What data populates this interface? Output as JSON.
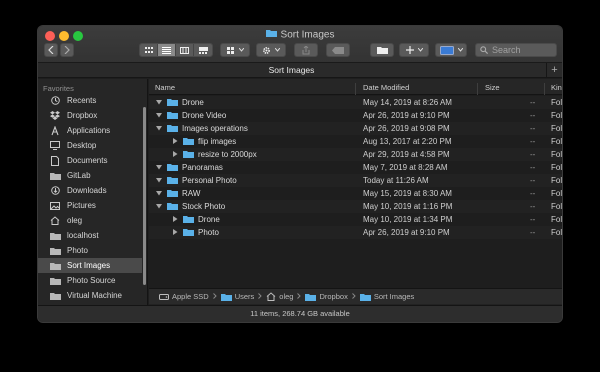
{
  "window": {
    "title": "Sort Images"
  },
  "toolbar": {
    "back_icon": "chevron-left-icon",
    "forward_icon": "chevron-right-icon",
    "view_modes": [
      "icon-view",
      "list-view",
      "column-view",
      "gallery-view"
    ],
    "selected_view": "list-view",
    "search_placeholder": "Search"
  },
  "tab": {
    "label": "Sort Images",
    "add_label": "+"
  },
  "sidebar": {
    "header": "Favorites",
    "items": [
      {
        "label": "Recents",
        "icon": "clock-icon"
      },
      {
        "label": "Dropbox",
        "icon": "dropbox-icon"
      },
      {
        "label": "Applications",
        "icon": "applications-icon"
      },
      {
        "label": "Desktop",
        "icon": "desktop-icon"
      },
      {
        "label": "Documents",
        "icon": "documents-icon"
      },
      {
        "label": "GitLab",
        "icon": "folder-icon"
      },
      {
        "label": "Downloads",
        "icon": "downloads-icon"
      },
      {
        "label": "Pictures",
        "icon": "pictures-icon"
      },
      {
        "label": "oleg",
        "icon": "home-icon"
      },
      {
        "label": "localhost",
        "icon": "folder-icon"
      },
      {
        "label": "Photo",
        "icon": "folder-icon"
      },
      {
        "label": "Sort Images",
        "icon": "folder-icon",
        "selected": true
      },
      {
        "label": "Photo Source",
        "icon": "folder-icon"
      },
      {
        "label": "Virtual Machine",
        "icon": "folder-icon"
      }
    ]
  },
  "columns": {
    "name": "Name",
    "date": "Date Modified",
    "size": "Size",
    "kind": "Kin"
  },
  "rows": [
    {
      "name": "Drone",
      "date": "May 14, 2019 at 8:26 AM",
      "size": "--",
      "kind": "Fol",
      "level": 0,
      "expanded": true
    },
    {
      "name": "Drone Video",
      "date": "Apr 26, 2019 at 9:10 PM",
      "size": "--",
      "kind": "Fol",
      "level": 0,
      "expanded": true
    },
    {
      "name": "Images operations",
      "date": "Apr 26, 2019 at 9:08 PM",
      "size": "--",
      "kind": "Fol",
      "level": 0,
      "expanded": true
    },
    {
      "name": "flip images",
      "date": "Aug 13, 2017 at 2:20 PM",
      "size": "--",
      "kind": "Fol",
      "level": 1,
      "expanded": false
    },
    {
      "name": "resize to 2000px",
      "date": "Apr 29, 2019 at 4:58 PM",
      "size": "--",
      "kind": "Fol",
      "level": 1,
      "expanded": false
    },
    {
      "name": "Panoramas",
      "date": "May 7, 2019 at 8:28 AM",
      "size": "--",
      "kind": "Fol",
      "level": 0,
      "expanded": true
    },
    {
      "name": "Personal Photo",
      "date": "Today at 11:26 AM",
      "size": "--",
      "kind": "Fol",
      "level": 0,
      "expanded": true
    },
    {
      "name": "RAW",
      "date": "May 15, 2019 at 8:30 AM",
      "size": "--",
      "kind": "Fol",
      "level": 0,
      "expanded": true
    },
    {
      "name": "Stock Photo",
      "date": "May 10, 2019 at 1:16 PM",
      "size": "--",
      "kind": "Fol",
      "level": 0,
      "expanded": true
    },
    {
      "name": "Drone",
      "date": "May 10, 2019 at 1:34 PM",
      "size": "--",
      "kind": "Fol",
      "level": 1,
      "expanded": false
    },
    {
      "name": "Photo",
      "date": "Apr 26, 2019 at 9:10 PM",
      "size": "--",
      "kind": "Fol",
      "level": 1,
      "expanded": false
    }
  ],
  "path": [
    {
      "label": "Apple SSD",
      "icon": "disk-icon"
    },
    {
      "label": "Users",
      "icon": "folder-icon"
    },
    {
      "label": "oleg",
      "icon": "home-icon"
    },
    {
      "label": "Dropbox",
      "icon": "folder-icon"
    },
    {
      "label": "Sort Images",
      "icon": "folder-icon"
    }
  ],
  "status": "11 items, 268.74 GB available",
  "colors": {
    "folder": "#5ab1e8",
    "selection": "#4a4a4a",
    "window_bg": "#1e1e1e"
  }
}
